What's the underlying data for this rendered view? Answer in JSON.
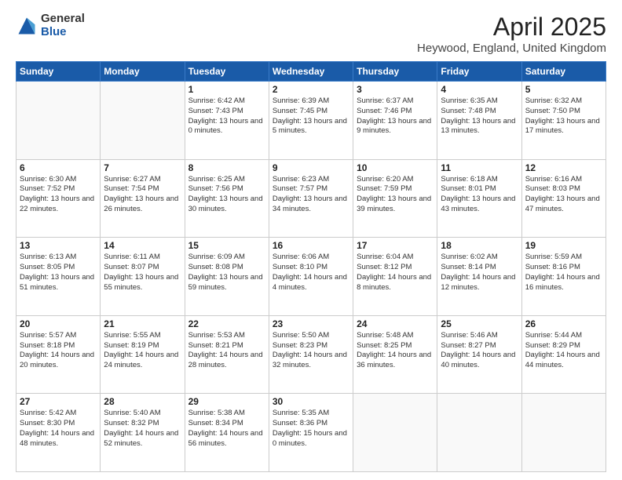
{
  "logo": {
    "general": "General",
    "blue": "Blue"
  },
  "title": "April 2025",
  "subtitle": "Heywood, England, United Kingdom",
  "days_of_week": [
    "Sunday",
    "Monday",
    "Tuesday",
    "Wednesday",
    "Thursday",
    "Friday",
    "Saturday"
  ],
  "weeks": [
    [
      {
        "day": "",
        "info": ""
      },
      {
        "day": "",
        "info": ""
      },
      {
        "day": "1",
        "info": "Sunrise: 6:42 AM\nSunset: 7:43 PM\nDaylight: 13 hours and 0 minutes."
      },
      {
        "day": "2",
        "info": "Sunrise: 6:39 AM\nSunset: 7:45 PM\nDaylight: 13 hours and 5 minutes."
      },
      {
        "day": "3",
        "info": "Sunrise: 6:37 AM\nSunset: 7:46 PM\nDaylight: 13 hours and 9 minutes."
      },
      {
        "day": "4",
        "info": "Sunrise: 6:35 AM\nSunset: 7:48 PM\nDaylight: 13 hours and 13 minutes."
      },
      {
        "day": "5",
        "info": "Sunrise: 6:32 AM\nSunset: 7:50 PM\nDaylight: 13 hours and 17 minutes."
      }
    ],
    [
      {
        "day": "6",
        "info": "Sunrise: 6:30 AM\nSunset: 7:52 PM\nDaylight: 13 hours and 22 minutes."
      },
      {
        "day": "7",
        "info": "Sunrise: 6:27 AM\nSunset: 7:54 PM\nDaylight: 13 hours and 26 minutes."
      },
      {
        "day": "8",
        "info": "Sunrise: 6:25 AM\nSunset: 7:56 PM\nDaylight: 13 hours and 30 minutes."
      },
      {
        "day": "9",
        "info": "Sunrise: 6:23 AM\nSunset: 7:57 PM\nDaylight: 13 hours and 34 minutes."
      },
      {
        "day": "10",
        "info": "Sunrise: 6:20 AM\nSunset: 7:59 PM\nDaylight: 13 hours and 39 minutes."
      },
      {
        "day": "11",
        "info": "Sunrise: 6:18 AM\nSunset: 8:01 PM\nDaylight: 13 hours and 43 minutes."
      },
      {
        "day": "12",
        "info": "Sunrise: 6:16 AM\nSunset: 8:03 PM\nDaylight: 13 hours and 47 minutes."
      }
    ],
    [
      {
        "day": "13",
        "info": "Sunrise: 6:13 AM\nSunset: 8:05 PM\nDaylight: 13 hours and 51 minutes."
      },
      {
        "day": "14",
        "info": "Sunrise: 6:11 AM\nSunset: 8:07 PM\nDaylight: 13 hours and 55 minutes."
      },
      {
        "day": "15",
        "info": "Sunrise: 6:09 AM\nSunset: 8:08 PM\nDaylight: 13 hours and 59 minutes."
      },
      {
        "day": "16",
        "info": "Sunrise: 6:06 AM\nSunset: 8:10 PM\nDaylight: 14 hours and 4 minutes."
      },
      {
        "day": "17",
        "info": "Sunrise: 6:04 AM\nSunset: 8:12 PM\nDaylight: 14 hours and 8 minutes."
      },
      {
        "day": "18",
        "info": "Sunrise: 6:02 AM\nSunset: 8:14 PM\nDaylight: 14 hours and 12 minutes."
      },
      {
        "day": "19",
        "info": "Sunrise: 5:59 AM\nSunset: 8:16 PM\nDaylight: 14 hours and 16 minutes."
      }
    ],
    [
      {
        "day": "20",
        "info": "Sunrise: 5:57 AM\nSunset: 8:18 PM\nDaylight: 14 hours and 20 minutes."
      },
      {
        "day": "21",
        "info": "Sunrise: 5:55 AM\nSunset: 8:19 PM\nDaylight: 14 hours and 24 minutes."
      },
      {
        "day": "22",
        "info": "Sunrise: 5:53 AM\nSunset: 8:21 PM\nDaylight: 14 hours and 28 minutes."
      },
      {
        "day": "23",
        "info": "Sunrise: 5:50 AM\nSunset: 8:23 PM\nDaylight: 14 hours and 32 minutes."
      },
      {
        "day": "24",
        "info": "Sunrise: 5:48 AM\nSunset: 8:25 PM\nDaylight: 14 hours and 36 minutes."
      },
      {
        "day": "25",
        "info": "Sunrise: 5:46 AM\nSunset: 8:27 PM\nDaylight: 14 hours and 40 minutes."
      },
      {
        "day": "26",
        "info": "Sunrise: 5:44 AM\nSunset: 8:29 PM\nDaylight: 14 hours and 44 minutes."
      }
    ],
    [
      {
        "day": "27",
        "info": "Sunrise: 5:42 AM\nSunset: 8:30 PM\nDaylight: 14 hours and 48 minutes."
      },
      {
        "day": "28",
        "info": "Sunrise: 5:40 AM\nSunset: 8:32 PM\nDaylight: 14 hours and 52 minutes."
      },
      {
        "day": "29",
        "info": "Sunrise: 5:38 AM\nSunset: 8:34 PM\nDaylight: 14 hours and 56 minutes."
      },
      {
        "day": "30",
        "info": "Sunrise: 5:35 AM\nSunset: 8:36 PM\nDaylight: 15 hours and 0 minutes."
      },
      {
        "day": "",
        "info": ""
      },
      {
        "day": "",
        "info": ""
      },
      {
        "day": "",
        "info": ""
      }
    ]
  ]
}
